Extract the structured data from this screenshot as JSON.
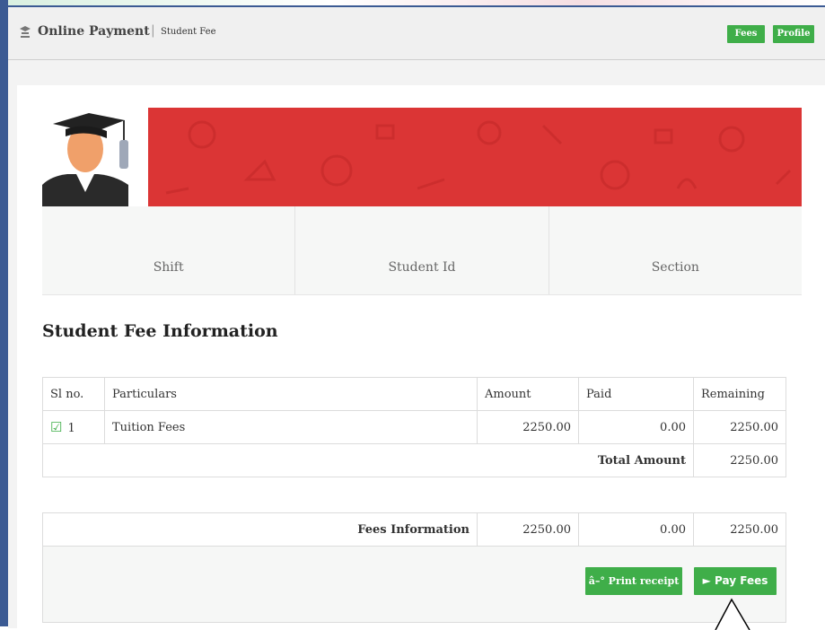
{
  "header": {
    "app_title": "Online Payment",
    "separator": "|",
    "breadcrumb": "Student Fee",
    "fees_label": "Fees",
    "profile_label": "Profile"
  },
  "student_info": {
    "columns": [
      "Shift",
      "Student Id",
      "Section"
    ]
  },
  "fee_section": {
    "title": "Student Fee Information",
    "table": {
      "headers": [
        "Sl no.",
        "Particulars",
        "Amount",
        "Paid",
        "Remaining"
      ],
      "rows": [
        {
          "sl": "1",
          "particulars": "Tuition Fees",
          "amount": "2250.00",
          "paid": "0.00",
          "remaining": "2250.00",
          "checked": true
        }
      ],
      "total_label": "Total Amount",
      "total_value": "2250.00"
    }
  },
  "summary": {
    "label": "Fees Information",
    "amount": "2250.00",
    "paid": "0.00",
    "remaining": "2250.00",
    "print_label": "â–° Print receipt",
    "pay_label": "► Pay Fees"
  },
  "colors": {
    "accent_green": "#3fae49",
    "banner_red": "#db3535",
    "frame_blue": "#3b5a93"
  },
  "icons": {
    "logo": "graduation-icon",
    "row_check": "checkbox-checked-icon"
  }
}
